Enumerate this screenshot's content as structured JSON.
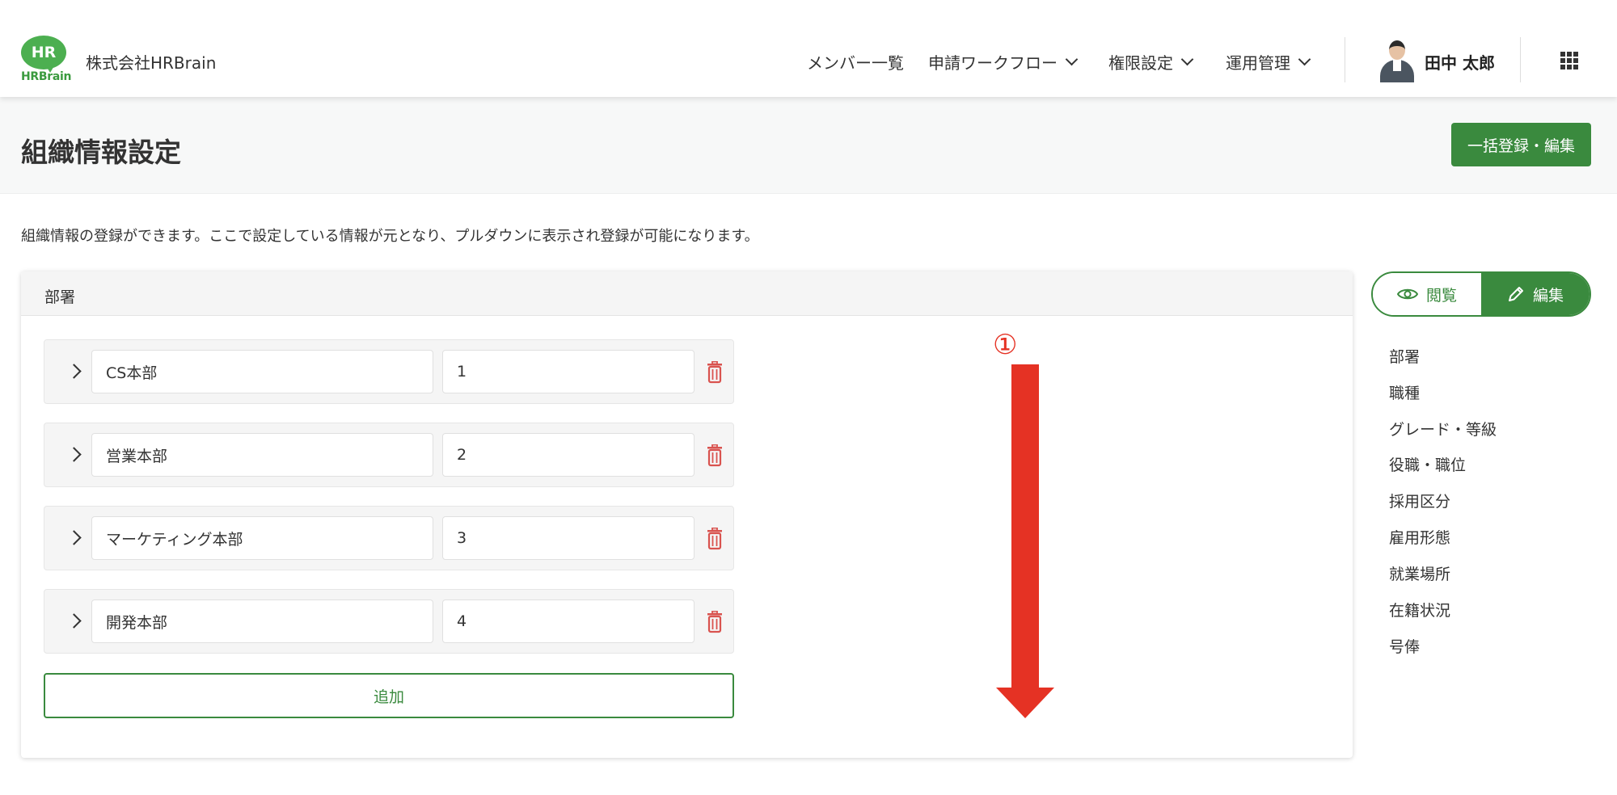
{
  "header": {
    "logo_mark": "HR",
    "logo_text": "HRBrain",
    "company": "株式会社HRBrain",
    "nav": [
      {
        "label": "メンバー一覧",
        "has_dropdown": false
      },
      {
        "label": "申請ワークフロー",
        "has_dropdown": true
      },
      {
        "label": "権限設定",
        "has_dropdown": true
      },
      {
        "label": "運用管理",
        "has_dropdown": true
      }
    ],
    "user_name": "田中 太郎",
    "apps_icon": "grid-icon"
  },
  "page": {
    "title": "組織情報設定",
    "bulk_button": "一括登録・編集",
    "description": "組織情報の登録ができます。ここで設定している情報が元となり、プルダウンに表示され登録が可能になります。"
  },
  "card": {
    "title": "部署",
    "rows": [
      {
        "name": "CS本部",
        "code": "1"
      },
      {
        "name": "営業本部",
        "code": "2"
      },
      {
        "name": "マーケティング本部",
        "code": "3"
      },
      {
        "name": "開発本部",
        "code": "4"
      }
    ],
    "add_button": "追加"
  },
  "annotation": {
    "number": "①",
    "color": "#e53224"
  },
  "toggle": {
    "view_label": "閲覧",
    "edit_label": "編集",
    "active": "edit"
  },
  "side_menu": [
    "部署",
    "職種",
    "グレード・等級",
    "役職・職位",
    "採用区分",
    "雇用形態",
    "就業場所",
    "在籍状況",
    "号俸"
  ],
  "colors": {
    "primary": "#3a8a3e",
    "danger": "#d9534f",
    "logo": "#4caf50"
  }
}
